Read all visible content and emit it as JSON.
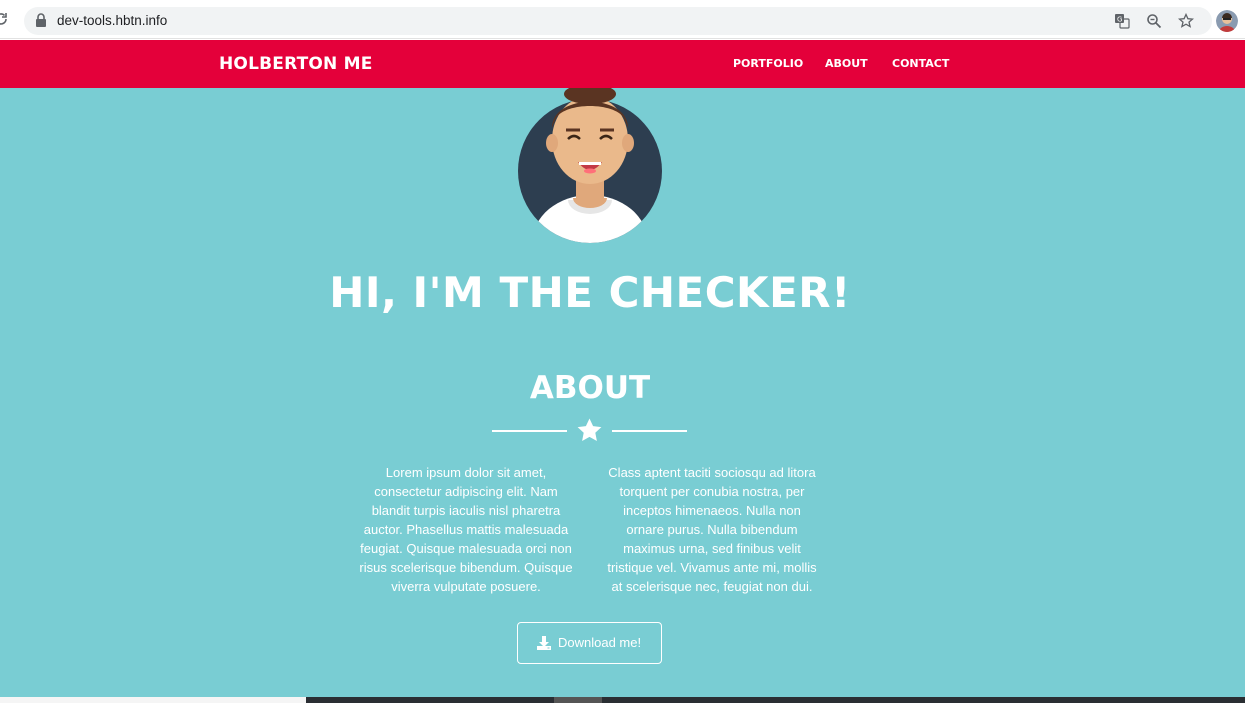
{
  "browser": {
    "url": "dev-tools.hbtn.info",
    "icons": [
      "reload-icon",
      "lock-icon",
      "translate-icon",
      "zoom-icon",
      "star-icon",
      "profile-avatar"
    ]
  },
  "nav": {
    "brand": "HOLBERTON ME",
    "links": [
      "PORTFOLIO",
      "ABOUT",
      "CONTACT"
    ]
  },
  "hero": {
    "title": "HI, I'M THE CHECKER!"
  },
  "about": {
    "title": "ABOUT",
    "col1": "Lorem ipsum dolor sit amet, consectetur adipiscing elit. Nam blandit turpis iaculis nisl pharetra auctor. Phasellus mattis malesuada feugiat. Quisque malesuada orci non risus scelerisque bibendum. Quisque viverra vulputate posuere.",
    "col2": "Class aptent taciti sociosqu ad litora torquent per conubia nostra, per inceptos himenaeos. Nulla non ornare purus. Nulla bibendum maximus urna, sed finibus velit tristique vel. Vivamus ante mi, mollis at scelerisque nec, feugiat non dui.",
    "button": "Download me!"
  },
  "colors": {
    "navbar": "#e4003a",
    "main_bg": "#79cdd3",
    "text": "#ffffff"
  }
}
